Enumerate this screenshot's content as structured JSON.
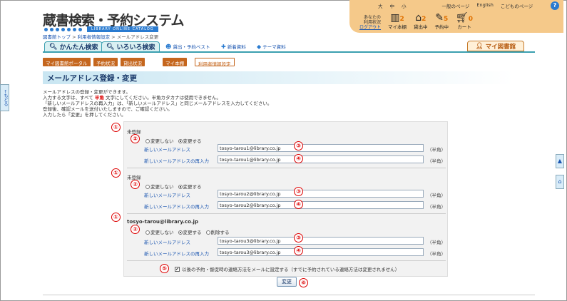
{
  "header": {
    "logo": "蔵書検索・予約システム",
    "logo_sub": "LIBRARY ONLINE CATALOG",
    "font_sizes": [
      "大",
      "中",
      "小"
    ],
    "links": [
      "一般のページ",
      "English",
      "こどものページ"
    ],
    "help": "?",
    "status_label_1": "あなたの",
    "status_label_2": "利用状況",
    "logout": "ログアウト",
    "items": [
      {
        "label": "マイ本棚",
        "count": "2",
        "icon": "shelf-icon"
      },
      {
        "label": "貸出中",
        "count": "2",
        "icon": "house-icon"
      },
      {
        "label": "予約中",
        "count": "5",
        "icon": "reserve-icon"
      },
      {
        "label": "カート",
        "count": "0",
        "icon": "cart-icon"
      }
    ]
  },
  "breadcrumb": {
    "home": "図書館トップ",
    "sep": " > ",
    "parent": "利用者情報設定",
    "current": "メールアドレス変更"
  },
  "tabs": {
    "simple": "かんたん検索",
    "advanced": "いろいろ検索",
    "best": "貸出・予約ベスト",
    "new": "新着資料",
    "theme": "テーマ資料",
    "mylib": "マイ図書館"
  },
  "subnav": [
    "マイ図書館ポータル",
    "予約状況",
    "貸出状況",
    "マイ本棚",
    "利用者情報設定"
  ],
  "page_title": "メールアドレス登録・変更",
  "intro": {
    "line1": "メールアドレスの登録・変更ができます。",
    "line2a": "入力する文字は、すべて",
    "line2b": "半角",
    "line2c": "文字にしてください。半角カタカナは使用できません。",
    "line3": "「新しいメールアドレスの再入力」は、「新しいメールアドレス」と同じメールアドレスを入力してください。",
    "line4": "登録後、確認メールを送付いたしますので、ご確認ください。",
    "line5": "入力したら「変更」を押してください。"
  },
  "side": {
    "back": "もどる",
    "top": "▲",
    "home": "⌂"
  },
  "sections": [
    {
      "current": "未登録",
      "radios": [
        "変更しない",
        "変更する"
      ],
      "selected": 1,
      "label_new": "新しいメールアドレス",
      "label_re": "新しいメールアドレスの再入力",
      "value_new": "tosyo-tarou1@library.co.jp",
      "value_re": "tosyo-tarou1@library.co.jp",
      "unit": "（半角）"
    },
    {
      "current": "未登録",
      "radios": [
        "変更しない",
        "変更する"
      ],
      "selected": 1,
      "label_new": "新しいメールアドレス",
      "label_re": "新しいメールアドレスの再入力",
      "value_new": "tosyo-tarou2@library.co.jp",
      "value_re": "tosyo-tarou2@library.co.jp",
      "unit": "（半角）"
    },
    {
      "current": "tosyo-tarou@library.co.jp",
      "radios": [
        "変更しない",
        "変更する",
        "削除する"
      ],
      "selected": 1,
      "label_new": "新しいメールアドレス",
      "label_re": "新しいメールアドレスの再入力",
      "value_new": "tosyo-tarou3@library.co.jp",
      "value_re": "tosyo-tarou3@library.co.jp",
      "unit": "（半角）"
    }
  ],
  "markers": {
    "m1": "①",
    "m2": "②",
    "m3": "③",
    "m4": "④",
    "m5": "⑤",
    "m6": "⑥"
  },
  "notify_checkbox": {
    "checked": true,
    "label": "以後の予約・督促時の連絡方法をメールに設定する（すでに予約されている連絡方法は変更されません）"
  },
  "submit_label": "変更"
}
